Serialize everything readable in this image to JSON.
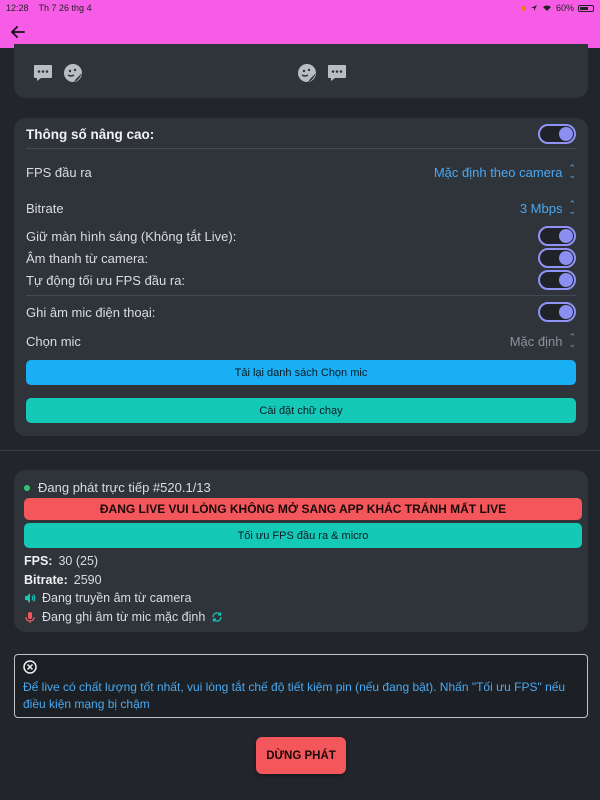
{
  "status_bar": {
    "time": "12:28",
    "date": "Th 7 26 thg 4",
    "battery": "60%"
  },
  "colors": {
    "header": "#f65ce6",
    "accent_blue": "#4aa8f0",
    "toggle": "#8c8ff2",
    "danger": "#f4575b",
    "teal": "#15c9b7",
    "button_blue": "#19aff5"
  },
  "advanced": {
    "title": "Thông số nâng cao:",
    "fps_label": "FPS đầu ra",
    "fps_value": "Mặc định theo camera",
    "bitrate_label": "Bitrate",
    "bitrate_value": "3 Mbps",
    "keep_screen_label": "Giữ màn hình sáng (Không tắt Live):",
    "camera_audio_label": "Âm thanh từ camera:",
    "auto_fps_label": "Tự động tối ưu FPS đầu ra:",
    "record_mic_label": "Ghi âm mic điện thoại:",
    "choose_mic_label": "Chọn mic",
    "choose_mic_value": "Mặc định",
    "reload_mic_button": "Tải lại danh sách Chọn mic",
    "ticker_button": "Cài đặt chữ chạy"
  },
  "live": {
    "title": "Đang phát trực tiếp #520.1/13",
    "warning": "ĐANG LIVE VUI LÒNG KHÔNG MỞ SANG APP KHÁC TRÁNH MẤT LIVE",
    "optimize_button": "Tối ưu FPS đầu ra & micro",
    "fps_label": "FPS:",
    "fps_value": "30 (25)",
    "bitrate_label": "Bitrate:",
    "bitrate_value": "2590",
    "camera_audio": "Đang truyền âm từ camera",
    "mic_recording": "Đang ghi âm từ mic mặc định"
  },
  "notice": {
    "text": "Để live có chất lượng tốt nhất, vui lòng tắt chế độ tiết kiệm pin (nếu đang bật). Nhấn \"Tối ưu FPS\" nếu điều kiện mạng bị chậm"
  },
  "stop_button": "DỪNG PHÁT"
}
